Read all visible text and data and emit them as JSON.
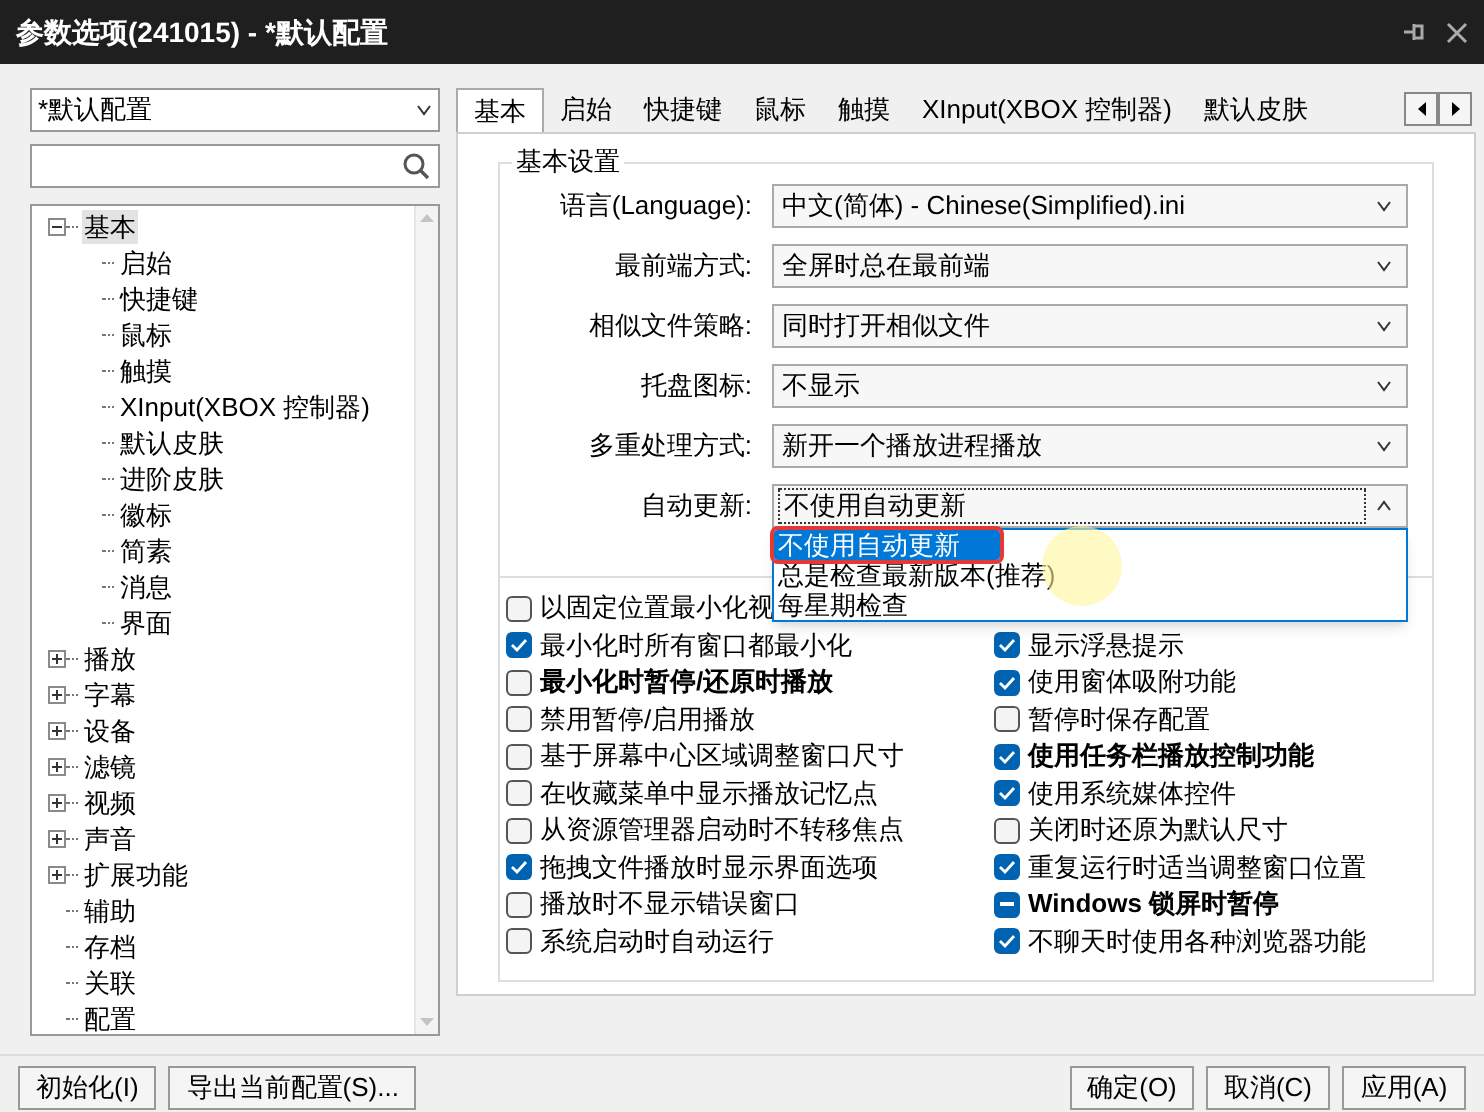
{
  "window": {
    "title": "参数选项(241015) - *默认配置"
  },
  "profile_select": {
    "value": "*默认配置"
  },
  "tree": [
    {
      "label": "基本",
      "expanded": true,
      "selected": true,
      "children": [
        {
          "label": "启始",
          "selected": false
        },
        {
          "label": "快捷键",
          "selected": false
        },
        {
          "label": "鼠标",
          "selected": false
        },
        {
          "label": "触摸",
          "selected": false
        },
        {
          "label": "XInput(XBOX 控制器)",
          "selected": false
        },
        {
          "label": "默认皮肤",
          "selected": false
        },
        {
          "label": "进阶皮肤",
          "selected": false
        },
        {
          "label": "徽标",
          "selected": false
        },
        {
          "label": "简素",
          "selected": false
        },
        {
          "label": "消息",
          "selected": false
        },
        {
          "label": "界面",
          "selected": false
        }
      ]
    },
    {
      "label": "播放",
      "expanded": false,
      "selected": false
    },
    {
      "label": "字幕",
      "expanded": false,
      "selected": false
    },
    {
      "label": "设备",
      "expanded": false,
      "selected": false
    },
    {
      "label": "滤镜",
      "expanded": false,
      "selected": false
    },
    {
      "label": "视频",
      "expanded": false,
      "selected": false
    },
    {
      "label": "声音",
      "expanded": false,
      "selected": false
    },
    {
      "label": "扩展功能",
      "expanded": false,
      "selected": false
    },
    {
      "label": "辅助",
      "selected": false
    },
    {
      "label": "存档",
      "selected": false
    },
    {
      "label": "关联",
      "selected": false
    },
    {
      "label": "配置",
      "selected": false
    }
  ],
  "left_buttons": [
    "初始化(I)",
    "导出当前配置(S)..."
  ],
  "tabs": [
    {
      "label": "基本",
      "selected": true
    },
    {
      "label": "启始",
      "selected": false
    },
    {
      "label": "快捷键",
      "selected": false
    },
    {
      "label": "鼠标",
      "selected": false
    },
    {
      "label": "触摸",
      "selected": false
    },
    {
      "label": "XInput(XBOX 控制器)",
      "selected": false
    },
    {
      "label": "默认皮肤",
      "selected": false
    }
  ],
  "group": {
    "title": "基本设置",
    "settings": [
      {
        "label": "语言(Language):",
        "value": "中文(简体) - Chinese(Simplified).ini",
        "open": false
      },
      {
        "label": "最前端方式:",
        "value": "全屏时总在最前端",
        "open": false
      },
      {
        "label": "相似文件策略:",
        "value": "同时打开相似文件",
        "open": false
      },
      {
        "label": "托盘图标:",
        "value": "不显示",
        "open": false
      },
      {
        "label": "多重处理方式:",
        "value": "新开一个播放进程播放",
        "open": false
      },
      {
        "label": "自动更新:",
        "value": "不使用自动更新",
        "open": true
      }
    ],
    "dropdown_options": [
      {
        "label": "不使用自动更新",
        "selected": true,
        "annotated": true
      },
      {
        "label": "总是检查最新版本(推荐)",
        "selected": false,
        "annotated": false
      },
      {
        "label": "每星期检查",
        "selected": false,
        "annotated": false
      }
    ],
    "checkbox_rows": [
      [
        {
          "label": "以固定位置最小化视",
          "checked": false,
          "indeterminate": false,
          "bold": false
        }
      ],
      [
        {
          "label": "最小化时所有窗口都最小化",
          "checked": true,
          "indeterminate": false,
          "bold": false
        },
        {
          "label": "显示浮悬提示",
          "checked": true,
          "indeterminate": false,
          "bold": false
        }
      ],
      [
        {
          "label": "最小化时暂停/还原时播放",
          "checked": false,
          "indeterminate": false,
          "bold": true
        },
        {
          "label": "使用窗体吸附功能",
          "checked": true,
          "indeterminate": false,
          "bold": false
        }
      ],
      [
        {
          "label": "禁用暂停/启用播放",
          "checked": false,
          "indeterminate": false,
          "bold": false
        },
        {
          "label": "暂停时保存配置",
          "checked": false,
          "indeterminate": false,
          "bold": false
        }
      ],
      [
        {
          "label": "基于屏幕中心区域调整窗口尺寸",
          "checked": false,
          "indeterminate": false,
          "bold": false
        },
        {
          "label": "使用任务栏播放控制功能",
          "checked": true,
          "indeterminate": false,
          "bold": true
        }
      ],
      [
        {
          "label": "在收藏菜单中显示播放记忆点",
          "checked": false,
          "indeterminate": false,
          "bold": false
        },
        {
          "label": "使用系统媒体控件",
          "checked": true,
          "indeterminate": false,
          "bold": false
        }
      ],
      [
        {
          "label": "从资源管理器启动时不转移焦点",
          "checked": false,
          "indeterminate": false,
          "bold": false
        },
        {
          "label": "关闭时还原为默认尺寸",
          "checked": false,
          "indeterminate": false,
          "bold": false
        }
      ],
      [
        {
          "label": "拖拽文件播放时显示界面选项",
          "checked": true,
          "indeterminate": false,
          "bold": false
        },
        {
          "label": "重复运行时适当调整窗口位置",
          "checked": true,
          "indeterminate": false,
          "bold": false
        }
      ],
      [
        {
          "label": "播放时不显示错误窗口",
          "checked": false,
          "indeterminate": false,
          "bold": false
        },
        {
          "label": "Windows 锁屏时暂停",
          "checked": true,
          "indeterminate": true,
          "bold": true
        }
      ],
      [
        {
          "label": "系统启动时自动运行",
          "checked": false,
          "indeterminate": false,
          "bold": false
        },
        {
          "label": "不聊天时使用各种浏览器功能",
          "checked": true,
          "indeterminate": false,
          "bold": false
        }
      ]
    ]
  },
  "dialog_buttons": [
    "确定(O)",
    "取消(C)",
    "应用(A)"
  ]
}
